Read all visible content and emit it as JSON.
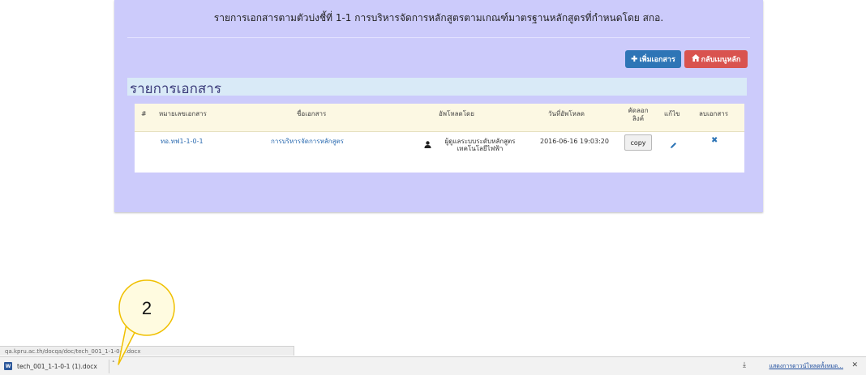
{
  "header": {
    "title": "รายการเอกสารตามตัวบ่งชี้ที่ 1-1 การบริหารจัดการหลักสูตรตามเกณฑ์มาตรฐานหลักสูตรที่กำหนดโดย สกอ."
  },
  "buttons": {
    "add_label": "เพิ่มเอกสาร",
    "home_label": "กลับเมนูหลัก"
  },
  "section": {
    "title": "รายการเอกสาร"
  },
  "table": {
    "columns": {
      "num": "#",
      "doc_id": "หมายเลขเอกสาร",
      "doc_name": "ชื่อเอกสาร",
      "uploader": "อัพโหลดโดย",
      "upload_date": "วันที่อัพโหลด",
      "copy_link_1": "คัดลอก",
      "copy_link_2": "ลิงค์",
      "edit": "แก้ไข",
      "delete": "ลบเอกสาร"
    },
    "rows": [
      {
        "doc_id": "ทอ.ทฟ1-1-0-1",
        "doc_name": "การบริหารจัดการหลักสูตร",
        "uploader_line1": "ผู้ดูแลระบบระดับหลักสูตร",
        "uploader_line2": "เทคโนโลยีไฟฟ้า",
        "upload_date": "2016-06-16 19:03:20",
        "copy_label": "copy"
      }
    ]
  },
  "status_bar": {
    "url": "qa.kpru.ac.th/docqa/doc/tech_001_1-1-0-1.docx"
  },
  "download_bar": {
    "filename": "tech_001_1-1-0-1 (1).docx",
    "show_all": "แสดงการดาวน์โหลดทั้งหมด..."
  },
  "callout": {
    "number": "2"
  },
  "colors": {
    "panel": "#cccbfb",
    "add_button": "#2e75b6",
    "home_button": "#d9534f",
    "table_header": "#fcf8e3",
    "callout_fill": "#fffbe0",
    "callout_stroke": "#f0c000"
  },
  "icons": {
    "add": "plus-icon",
    "home": "home-icon",
    "uploader": "user-icon",
    "edit": "pencil-icon",
    "delete": "close-icon",
    "file": "word-doc-icon",
    "download": "download-icon"
  }
}
